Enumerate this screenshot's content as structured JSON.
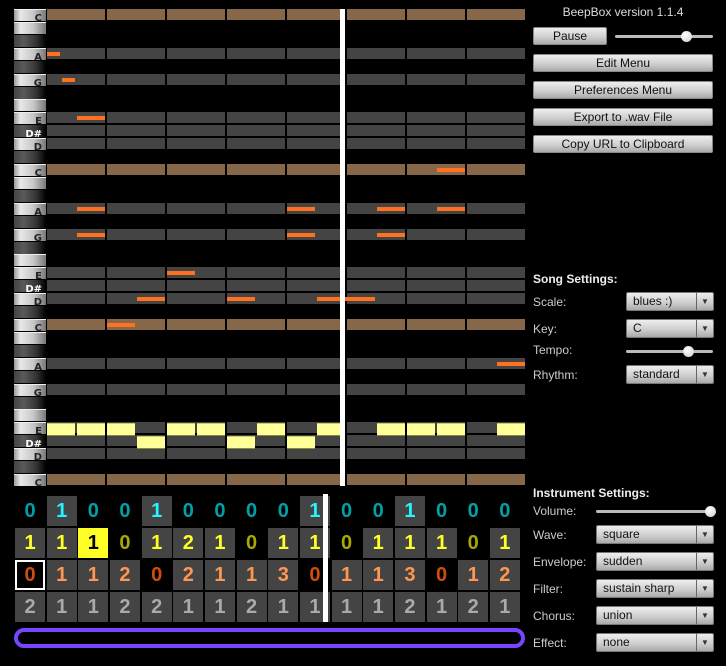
{
  "piano_roll": {
    "octaves": 3,
    "scale_pitch_classes": [
      0,
      2,
      3,
      4,
      7,
      9
    ],
    "key_labels": {
      "0": "C",
      "2": "D",
      "3": "D#",
      "4": "E",
      "7": "G",
      "9": "A"
    },
    "beats": 8,
    "colors": {
      "tonic_row": "#876749",
      "scale_row": "#444444",
      "other_channel_note": "#ff7020",
      "current_channel_note": "#ffff99",
      "playhead": "#ffffff"
    },
    "playhead_beat": 4.95,
    "other_channel_notes": [
      {
        "pitch": 33,
        "start": 0,
        "end": 0.25
      },
      {
        "pitch": 31,
        "start": 0.25,
        "end": 0.5
      },
      {
        "pitch": 28,
        "start": 0.5,
        "end": 1
      },
      {
        "pitch": 24,
        "start": 6.5,
        "end": 7
      },
      {
        "pitch": 21,
        "start": 0.5,
        "end": 1
      },
      {
        "pitch": 21,
        "start": 4,
        "end": 4.5
      },
      {
        "pitch": 21,
        "start": 5.5,
        "end": 6
      },
      {
        "pitch": 21,
        "start": 6.5,
        "end": 7
      },
      {
        "pitch": 19,
        "start": 0.5,
        "end": 1
      },
      {
        "pitch": 19,
        "start": 4,
        "end": 4.5
      },
      {
        "pitch": 19,
        "start": 5.5,
        "end": 6
      },
      {
        "pitch": 16,
        "start": 2,
        "end": 2.5
      },
      {
        "pitch": 14,
        "start": 1.5,
        "end": 2
      },
      {
        "pitch": 14,
        "start": 3,
        "end": 3.5
      },
      {
        "pitch": 14,
        "start": 4.5,
        "end": 5.5
      },
      {
        "pitch": 12,
        "start": 1,
        "end": 1.5
      },
      {
        "pitch": 9,
        "start": 7.5,
        "end": 8
      }
    ],
    "current_channel_notes": [
      {
        "pitch": 4,
        "start": 0,
        "end": 0.5
      },
      {
        "pitch": 4,
        "start": 0.5,
        "end": 1
      },
      {
        "pitch": 4,
        "start": 1,
        "end": 1.5
      },
      {
        "pitch": 3,
        "start": 1.5,
        "end": 2
      },
      {
        "pitch": 4,
        "start": 2,
        "end": 2.5
      },
      {
        "pitch": 4,
        "start": 2.5,
        "end": 3
      },
      {
        "pitch": 3,
        "start": 3,
        "end": 3.5
      },
      {
        "pitch": 4,
        "start": 3.5,
        "end": 4
      },
      {
        "pitch": 3,
        "start": 4,
        "end": 4.5
      },
      {
        "pitch": 4,
        "start": 4.5,
        "end": 5
      },
      {
        "pitch": 4,
        "start": 5.5,
        "end": 6
      },
      {
        "pitch": 4,
        "start": 6,
        "end": 6.5
      },
      {
        "pitch": 4,
        "start": 6.5,
        "end": 7
      },
      {
        "pitch": 4,
        "start": 7.5,
        "end": 8
      }
    ]
  },
  "pattern_grid": {
    "playhead_bar": 9.8,
    "selected": {
      "channel": 2,
      "bar": 0
    },
    "highlighted": {
      "channel": 1,
      "bar": 2
    },
    "channels": [
      {
        "color": "#25f3ff",
        "dim": "#00a0a8",
        "bars": [
          0,
          1,
          0,
          0,
          1,
          0,
          0,
          0,
          0,
          1,
          0,
          0,
          1,
          0,
          0,
          0
        ]
      },
      {
        "color": "#ffff25",
        "dim": "#a8a800",
        "bars": [
          1,
          1,
          1,
          0,
          1,
          2,
          1,
          0,
          1,
          1,
          0,
          1,
          1,
          1,
          0,
          1
        ]
      },
      {
        "color": "#ff9752",
        "dim": "#d04e0a",
        "bars": [
          0,
          1,
          1,
          2,
          0,
          2,
          1,
          1,
          3,
          0,
          1,
          1,
          3,
          0,
          1,
          2
        ]
      },
      {
        "color": "#aaaaaa",
        "dim": "#777777",
        "bars": [
          2,
          1,
          1,
          2,
          2,
          1,
          1,
          2,
          1,
          1,
          1,
          1,
          2,
          1,
          2,
          1
        ]
      }
    ],
    "loop_color": "#7744ff"
  },
  "header": {
    "title": "BeepBox version 1.1.4"
  },
  "controls": {
    "pause_label": "Pause",
    "volume_slider_value": 0.72,
    "edit_menu": "Edit Menu",
    "preferences_menu": "Preferences Menu",
    "export_wav": "Export to .wav File",
    "copy_url": "Copy URL to Clipboard"
  },
  "song_settings": {
    "heading": "Song Settings:",
    "scale_label": "Scale:",
    "scale_value": "blues :)",
    "key_label": "Key:",
    "key_value": "C",
    "tempo_label": "Tempo:",
    "tempo_value": 0.71,
    "rhythm_label": "Rhythm:",
    "rhythm_value": "standard"
  },
  "instrument_settings": {
    "heading": "Instrument Settings:",
    "volume_label": "Volume:",
    "volume_value": 1.0,
    "wave_label": "Wave:",
    "wave_value": "square",
    "envelope_label": "Envelope:",
    "envelope_value": "sudden",
    "filter_label": "Filter:",
    "filter_value": "sustain sharp",
    "chorus_label": "Chorus:",
    "chorus_value": "union",
    "effect_label": "Effect:",
    "effect_value": "none"
  },
  "icons": {
    "dropdown": "chevron-down-icon"
  }
}
